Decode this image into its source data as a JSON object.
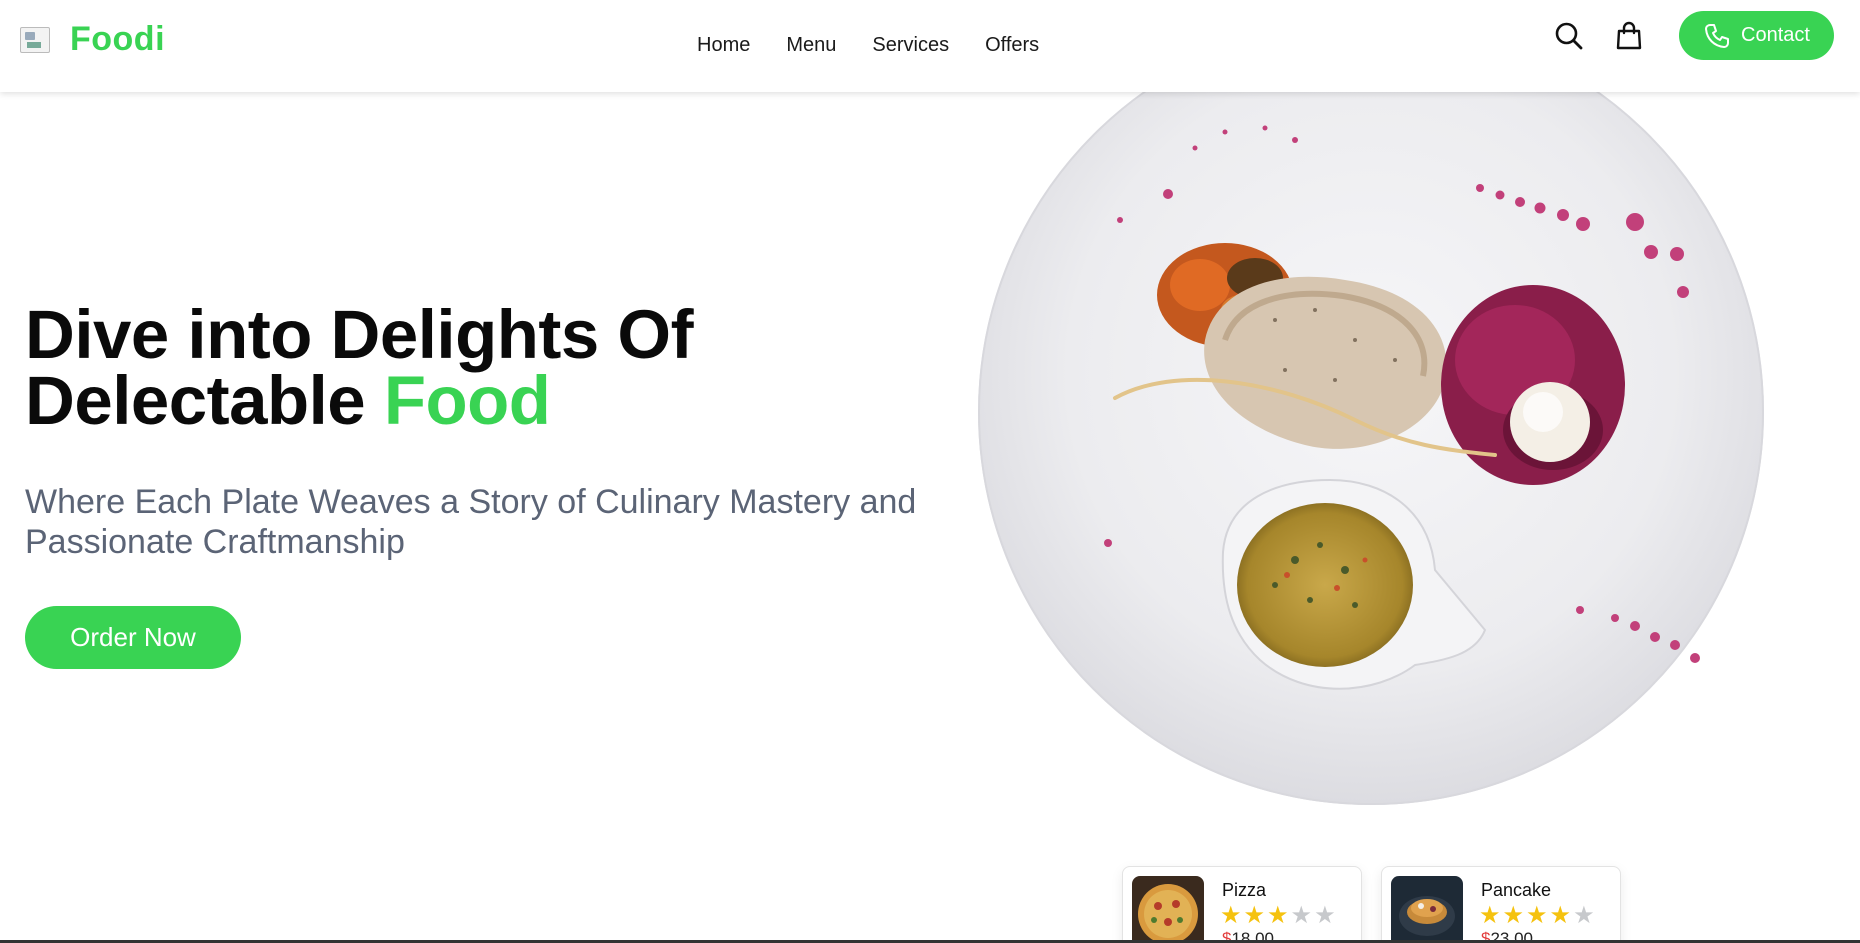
{
  "header": {
    "brand": "Foodi",
    "nav": [
      "Home",
      "Menu",
      "Services",
      "Offers"
    ],
    "contact_label": "Contact"
  },
  "hero": {
    "title_line1": "Dive into Delights Of",
    "title_line2_prefix": "Delectable ",
    "title_line2_accent": "Food",
    "subtitle": "Where Each Plate Weaves a Story of Culinary Mastery and Passionate Craftmanship",
    "order_button": "Order Now"
  },
  "cards": [
    {
      "name": "Pizza",
      "rating": 3,
      "max_rating": 5,
      "currency": "$",
      "price": "18.00"
    },
    {
      "name": "Pancake",
      "rating": 4,
      "max_rating": 5,
      "currency": "$",
      "price": "23.00"
    }
  ],
  "colors": {
    "accent": "#39d353",
    "text_gray": "#5b6476",
    "star": "#f5c20f",
    "price_currency": "#e23b3b"
  },
  "icons": [
    "logo-image-icon",
    "search-icon",
    "shopping-bag-icon",
    "phone-icon",
    "star-icon"
  ]
}
